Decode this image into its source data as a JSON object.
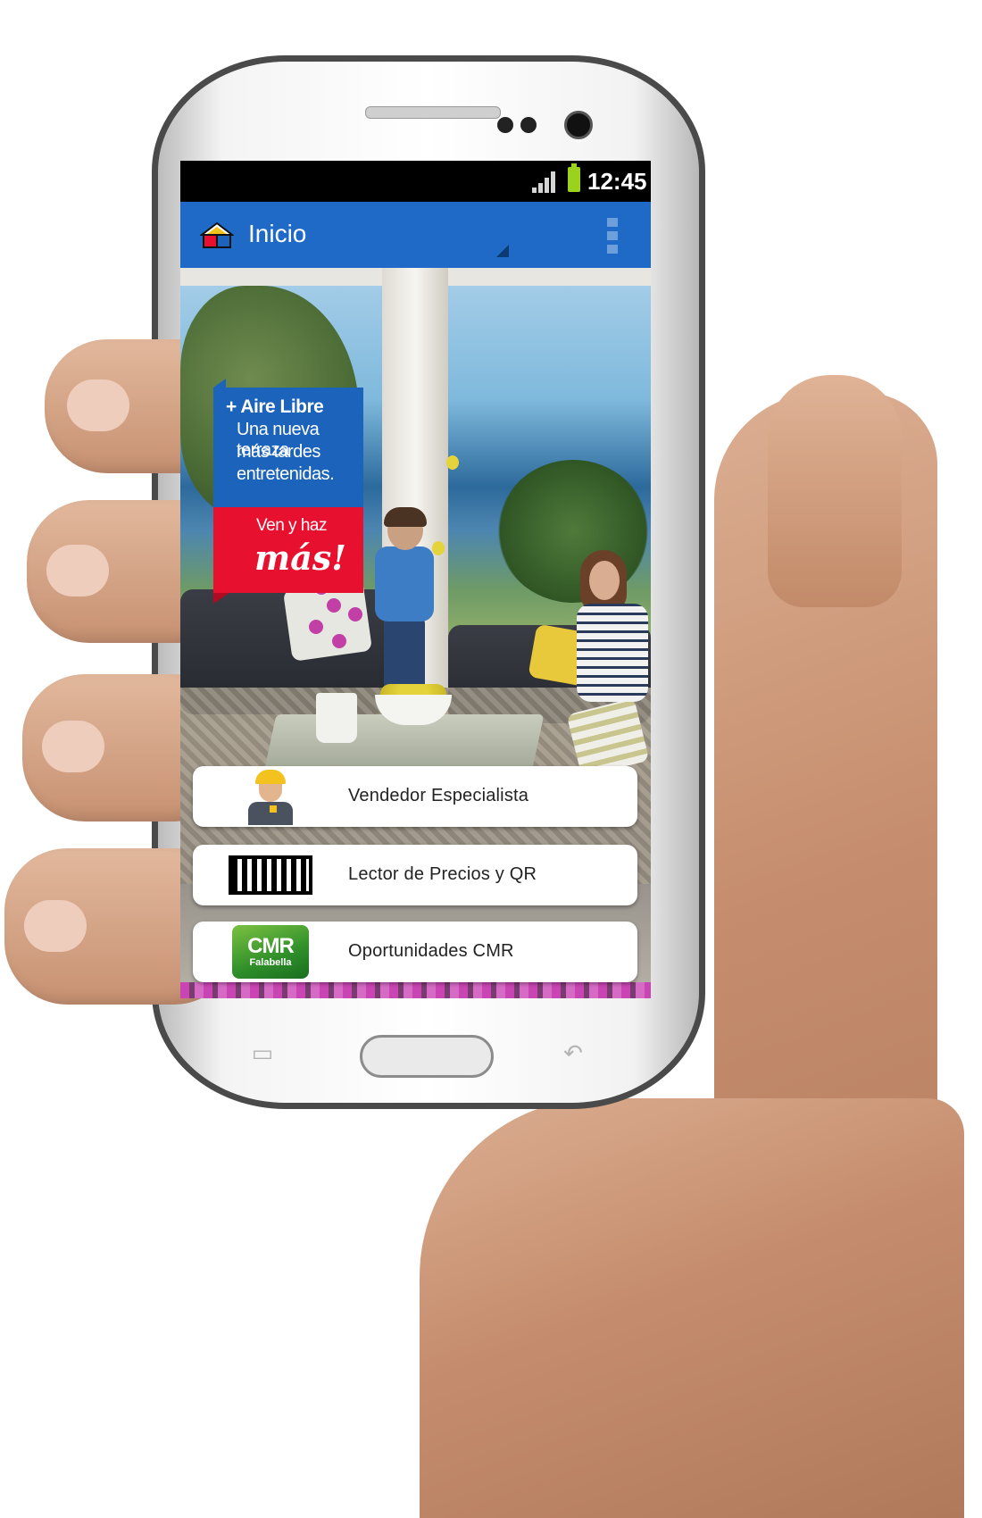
{
  "status_bar": {
    "time": "12:45",
    "signal_icon": "signal-icon",
    "battery_icon": "battery-icon"
  },
  "app_bar": {
    "logo_icon": "house-logo-icon",
    "title": "Inicio",
    "overflow_icon": "overflow-menu-icon",
    "color": "#1f6ac6"
  },
  "promo": {
    "title": "+ Aire Libre",
    "lines": [
      "Una nueva terraza",
      "más tardes",
      "entretenidas."
    ],
    "cta_small": "Ven y haz",
    "cta_big": "más!",
    "blue": "#1c63bc",
    "red": "#e8102f"
  },
  "menu": [
    {
      "label": "Vendedor Especialista",
      "icon": "worker-icon"
    },
    {
      "label": "Lector de Precios y QR",
      "icon": "barcode-icon"
    },
    {
      "label": "Oportunidades CMR",
      "icon": "cmr-falabella-icon",
      "icon_text": "CMR",
      "icon_subtext": "Falabella"
    }
  ],
  "soft_keys": {
    "menu_icon": "menu-key-icon",
    "back_icon": "back-key-icon",
    "home_icon": "home-button-icon"
  }
}
